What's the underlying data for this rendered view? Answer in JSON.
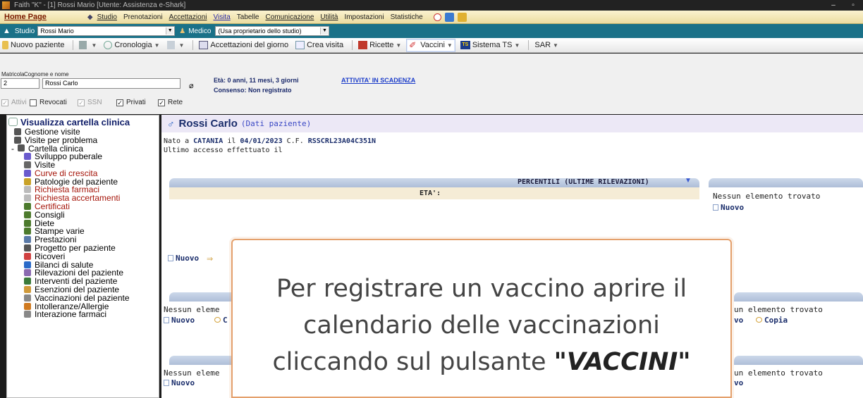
{
  "window": {
    "title": "Faith \"K\" - [1] Rossi Mario [Utente: Assistenza e-Shark]",
    "minimize": "–",
    "maximize": "▫"
  },
  "menu": {
    "home": "Home Page",
    "items": [
      "Studio",
      "Prenotazioni",
      "Accettazioni",
      "Visita",
      "Tabelle",
      "Comunicazione",
      "Utilità",
      "Impostazioni",
      "Statistiche"
    ]
  },
  "studiobar": {
    "studio_label": "Studio",
    "studio_value": "Rossi Mario",
    "medico_label": "Medico",
    "medico_value": "(Usa proprietario dello studio)"
  },
  "toolbar": {
    "new_patient": "Nuovo paziente",
    "history": "Cronologia",
    "acceptances": "Accettazioni del giorno",
    "create_visit": "Crea visita",
    "recipes": "Ricette",
    "vaccines": "Vaccini",
    "ts_system": "Sistema TS",
    "sar": "SAR"
  },
  "patient": {
    "matricola_label": "Matricola",
    "matricola_value": "2",
    "name_label": "Cognome e nome",
    "name_value": "Rossi Carlo",
    "age": "Età: 0 anni, 11 mesi, 3 giorni",
    "consent": "Consenso: Non registrato",
    "activity_link": "ATTIVITA' IN SCADENZA",
    "checks": [
      {
        "label": "Attivi",
        "checked": true,
        "disabled": true
      },
      {
        "label": "Revocati",
        "checked": false,
        "disabled": false
      },
      {
        "label": "SSN",
        "checked": true,
        "disabled": true
      },
      {
        "label": "Privati",
        "checked": true,
        "disabled": false
      },
      {
        "label": "Rete",
        "checked": true,
        "disabled": false
      }
    ]
  },
  "sidebar": {
    "title": "Visualizza cartella clinica",
    "items": [
      {
        "label": "Gestione visite",
        "indent": 1,
        "icon": "visits-icon",
        "color": "#555"
      },
      {
        "label": "Visite per problema",
        "indent": 1,
        "icon": "problem-visits-icon",
        "color": "#555"
      },
      {
        "label": "Cartella clinica",
        "indent": 0,
        "prefix": "-",
        "icon": "clinical-folder-icon",
        "color": "#555"
      },
      {
        "label": "Sviluppo puberale",
        "indent": 2,
        "icon": "puberty-icon",
        "color": "#6a5acd"
      },
      {
        "label": "Visite",
        "indent": 2,
        "icon": "visit-doc-icon",
        "color": "#666"
      },
      {
        "label": "Curve di crescita",
        "indent": 2,
        "icon": "growth-icon",
        "color": "#6a5acd",
        "red": true
      },
      {
        "label": "Patologie del paziente",
        "indent": 2,
        "icon": "pathology-icon",
        "color": "#c9a227"
      },
      {
        "label": "Richiesta farmaci",
        "indent": 2,
        "icon": "drug-request-icon",
        "color": "#bbb",
        "red": true
      },
      {
        "label": "Richiesta accertamenti",
        "indent": 2,
        "icon": "exam-request-icon",
        "color": "#bbb",
        "red": true
      },
      {
        "label": "Certificati",
        "indent": 2,
        "icon": "certificate-icon",
        "color": "#4c7a2c",
        "red": true
      },
      {
        "label": "Consigli",
        "indent": 2,
        "icon": "advice-icon",
        "color": "#4c7a2c"
      },
      {
        "label": "Diete",
        "indent": 2,
        "icon": "diet-icon",
        "color": "#4c7a2c"
      },
      {
        "label": "Stampe varie",
        "indent": 2,
        "icon": "print-icon",
        "color": "#4c7a2c"
      },
      {
        "label": "Prestazioni",
        "indent": 2,
        "icon": "services-icon",
        "color": "#5a7aa8"
      },
      {
        "label": "Progetto per paziente",
        "indent": 2,
        "icon": "project-icon",
        "color": "#555"
      },
      {
        "label": "Ricoveri",
        "indent": 2,
        "icon": "hospital-icon",
        "color": "#d04040"
      },
      {
        "label": "Bilanci di salute",
        "indent": 2,
        "icon": "health-balance-icon",
        "color": "#2a6ac8"
      },
      {
        "label": "Rilevazioni del paziente",
        "indent": 2,
        "icon": "measurements-icon",
        "color": "#8a6ab0"
      },
      {
        "label": "Interventi del paziente",
        "indent": 2,
        "icon": "surgery-icon",
        "color": "#3a7a3a"
      },
      {
        "label": "Esenzioni del paziente",
        "indent": 2,
        "icon": "exemption-icon",
        "color": "#d09a3a"
      },
      {
        "label": "Vaccinazioni del paziente",
        "indent": 2,
        "icon": "vaccination-icon",
        "color": "#888"
      },
      {
        "label": "Intolleranze/Allergie",
        "indent": 2,
        "icon": "allergy-icon",
        "color": "#d07a20"
      },
      {
        "label": "Interazione farmaci",
        "indent": 2,
        "icon": "drug-interaction-icon",
        "color": "#888"
      }
    ]
  },
  "main": {
    "sex_symbol": "♂",
    "patient_name": "Rossi Carlo",
    "patient_sub": "(Dati paziente)",
    "birth_prefix": "Nato a ",
    "birth_city": "CATANIA",
    "birth_mid": " il ",
    "birth_date": "04/01/2023",
    "cf_prefix": " C.F. ",
    "cf": "RSSCRL23A04C351N",
    "last_access": "Ultimo accesso effettuato il",
    "percentiles_title": "PERCENTILI (ULTIME RILEVAZIONI)",
    "eta_label": "ETA':",
    "no_items": "Nessun elemento trovato",
    "no_items_trunc": "Nessun eleme",
    "no_items_right": "un elemento trovato",
    "new": "Nuovo",
    "new_trunc": "vo",
    "copy": "Copia",
    "copy_trunc": "C"
  },
  "overlay": {
    "line1": "Per registrare un vaccino aprire il",
    "line2": "calendario delle vaccinazioni",
    "line3_pre": "cliccando sul pulsante ",
    "line3_bold": "\"VACCINI\""
  }
}
